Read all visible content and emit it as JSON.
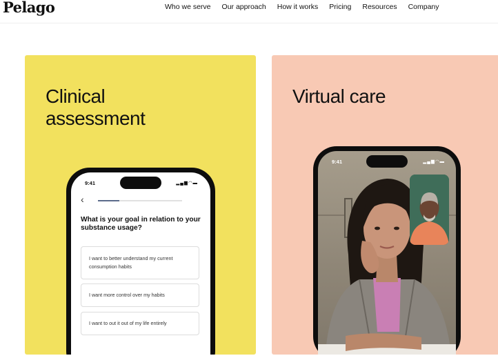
{
  "header": {
    "logo": "Pelago",
    "nav": [
      "Who we serve",
      "Our approach",
      "How it works",
      "Pricing",
      "Resources",
      "Company"
    ]
  },
  "cards": {
    "clinical": {
      "title": "Clinical assessment",
      "color": "#f2e15e",
      "phone": {
        "time": "9:41",
        "progress": 0.25,
        "question": "What is your goal in relation to your substance usage?",
        "options": [
          "I want to better understand my current consumption habits",
          "I want more control over my habits",
          "I want to out it out of my life entirely"
        ]
      }
    },
    "virtual": {
      "title": "Virtual care",
      "color": "#f8c9b4",
      "phone": {
        "time": "9:41"
      }
    }
  }
}
